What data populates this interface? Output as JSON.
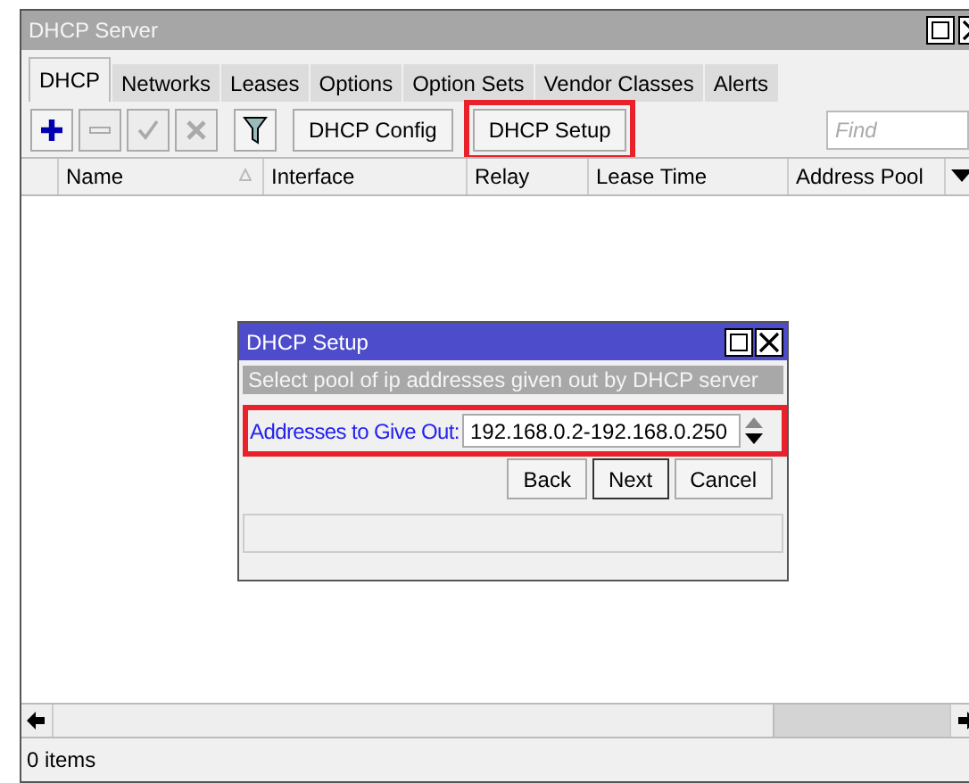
{
  "window": {
    "title": "DHCP Server"
  },
  "tabs": [
    {
      "label": "DHCP",
      "selected": true
    },
    {
      "label": "Networks",
      "selected": false
    },
    {
      "label": "Leases",
      "selected": false
    },
    {
      "label": "Options",
      "selected": false
    },
    {
      "label": "Option Sets",
      "selected": false
    },
    {
      "label": "Vendor Classes",
      "selected": false
    },
    {
      "label": "Alerts",
      "selected": false
    }
  ],
  "toolbar": {
    "icon_buttons": [
      {
        "kind": "add",
        "disabled": false
      },
      {
        "kind": "remove",
        "disabled": true
      },
      {
        "kind": "enable",
        "disabled": true
      },
      {
        "kind": "disable",
        "disabled": true
      },
      {
        "kind": "filter",
        "disabled": false
      }
    ],
    "buttons": [
      {
        "label": "DHCP Config",
        "highlighted": false
      },
      {
        "label": "DHCP Setup",
        "highlighted": true
      }
    ],
    "search": {
      "placeholder": "Find"
    }
  },
  "table": {
    "columns": [
      {
        "label": "Name",
        "sorted": true
      },
      {
        "label": "Interface",
        "sorted": false
      },
      {
        "label": "Relay",
        "sorted": false
      },
      {
        "label": "Lease Time",
        "sorted": false
      },
      {
        "label": "Address Pool",
        "sorted": false
      }
    ]
  },
  "status_bar": {
    "text": "0 items"
  },
  "dialog": {
    "title": "DHCP Setup",
    "subtitle": "Select pool of ip addresses given out by DHCP server",
    "field": {
      "label": "Addresses to Give Out:",
      "value": "192.168.0.2-192.168.0.250",
      "highlighted": true
    },
    "buttons": [
      {
        "label": "Back",
        "default": false
      },
      {
        "label": "Next",
        "default": true
      },
      {
        "label": "Cancel",
        "default": false
      }
    ]
  }
}
